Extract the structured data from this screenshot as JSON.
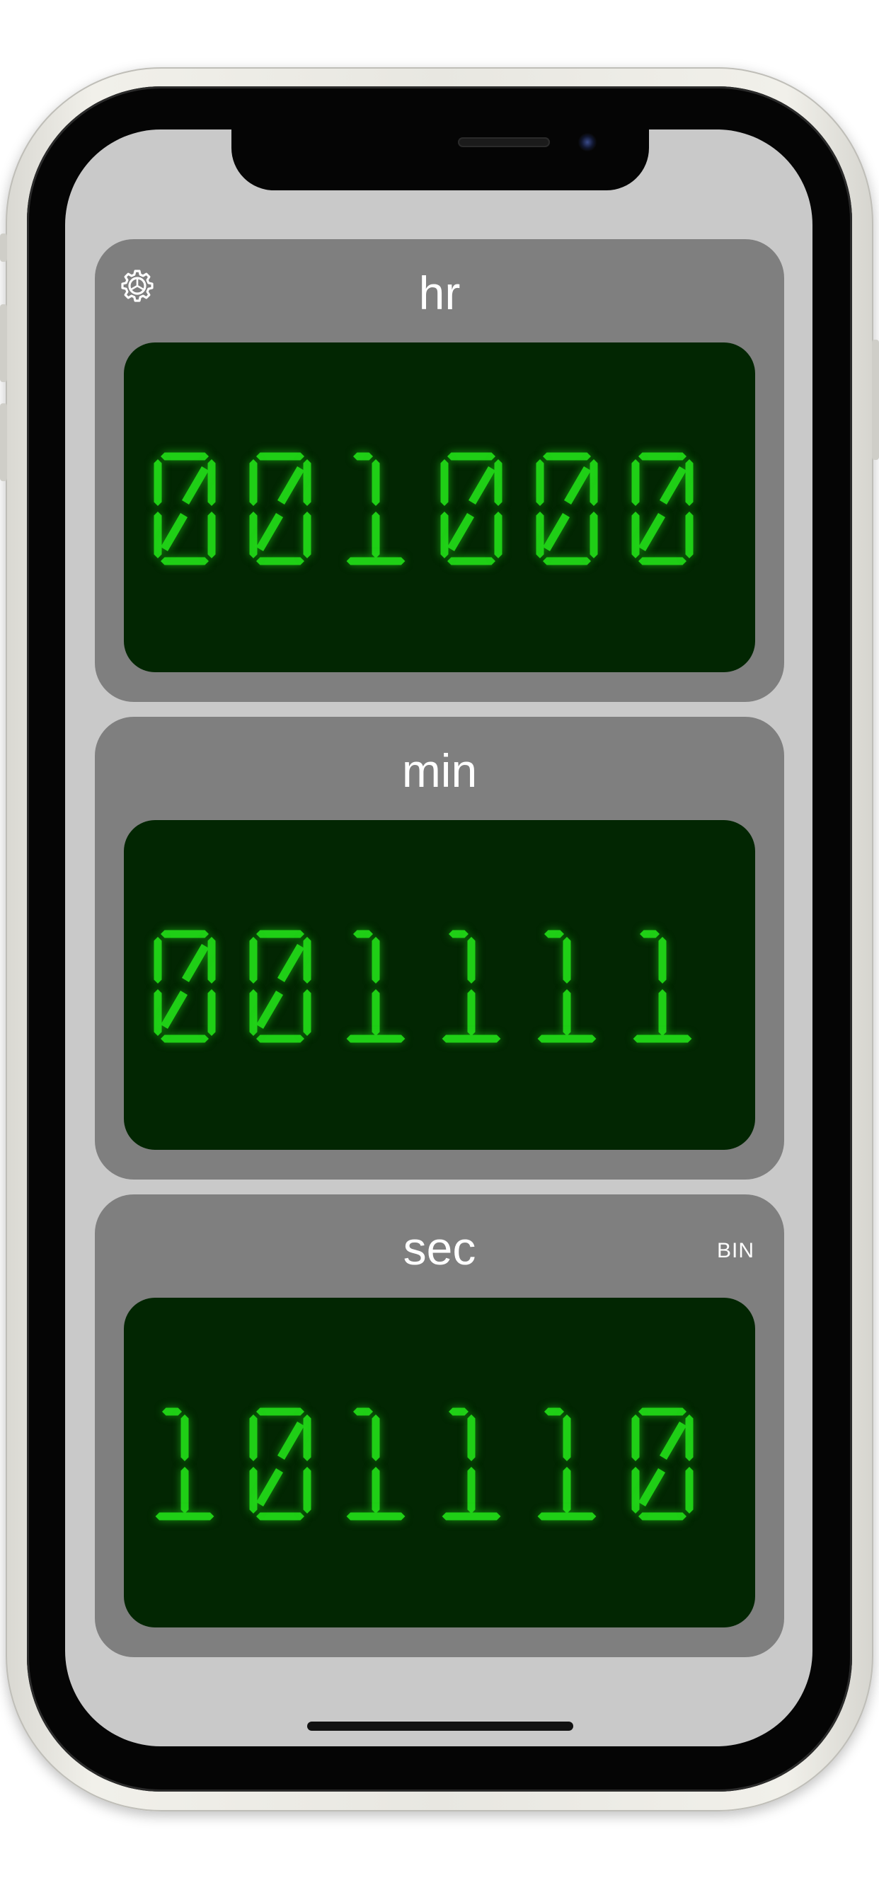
{
  "app": {
    "settings_icon": "gear-icon",
    "accent_color": "#1fcf16",
    "display_background": "#022602",
    "card_background": "#7f7f7f",
    "screen_background": "#c9c9c9"
  },
  "panels": [
    {
      "id": "hours",
      "label": "hr",
      "digits": "001000",
      "mode": ""
    },
    {
      "id": "minutes",
      "label": "min",
      "digits": "001111",
      "mode": ""
    },
    {
      "id": "seconds",
      "label": "sec",
      "digits": "101110",
      "mode": "BIN"
    }
  ]
}
